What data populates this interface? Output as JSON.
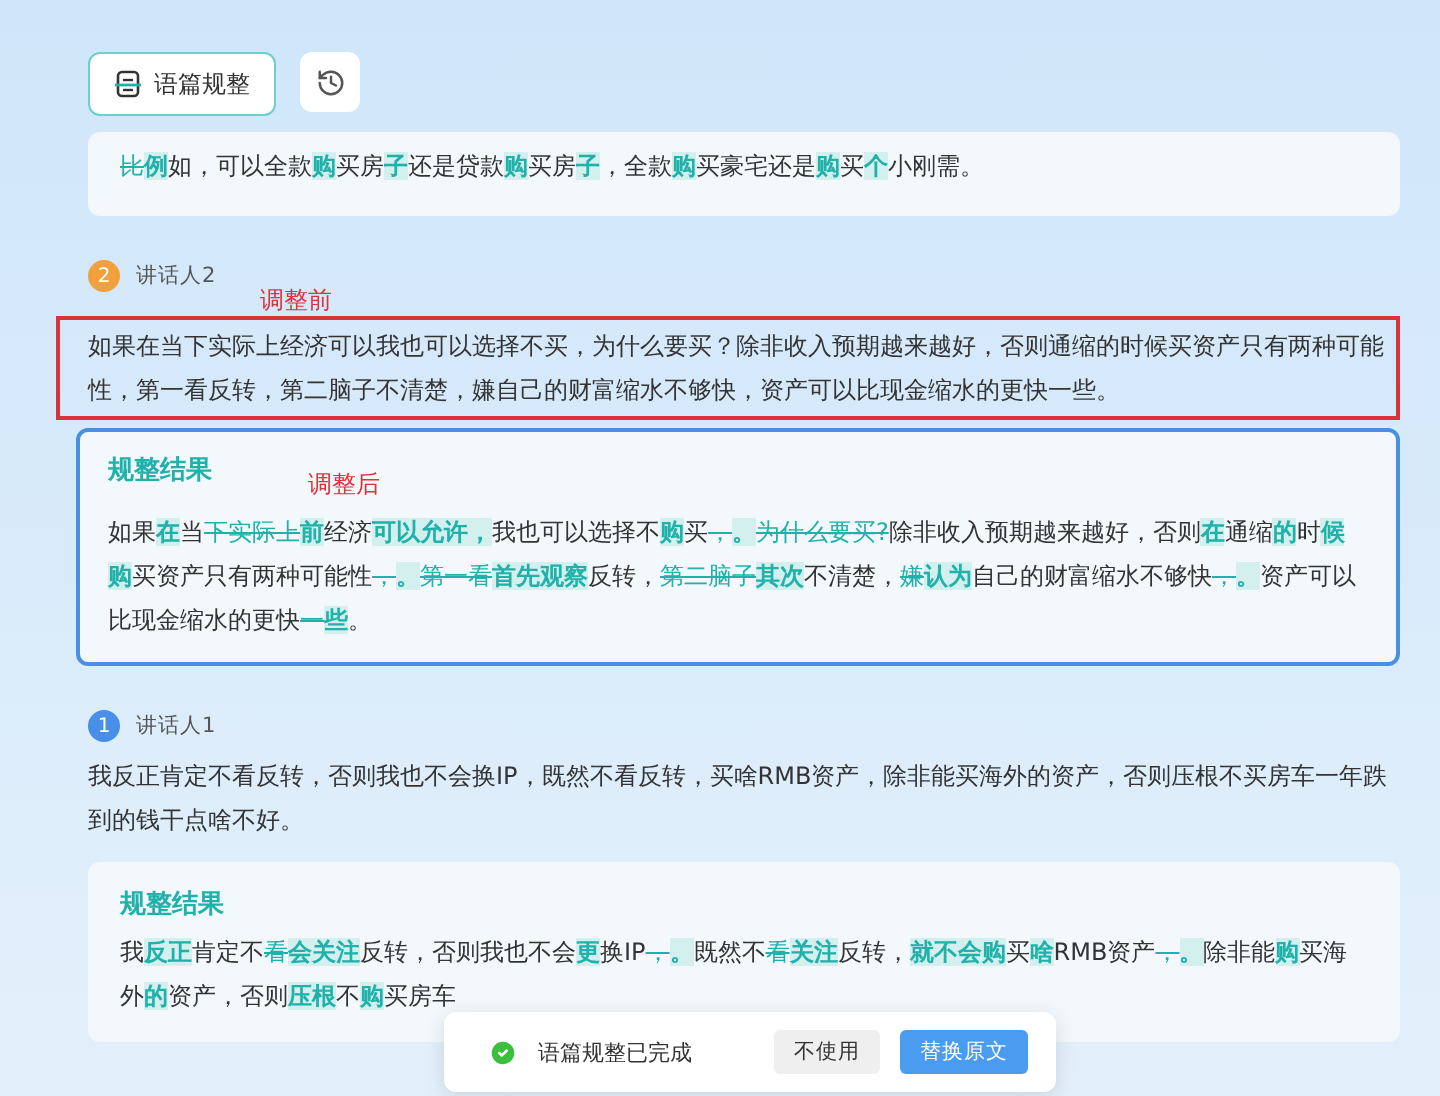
{
  "toolbar": {
    "tidy_button": "语篇规整"
  },
  "blocks": [
    {
      "framed": false,
      "result": [
        {
          "kind": "removed",
          "text": "比"
        },
        {
          "kind": "added",
          "text": "例"
        },
        {
          "kind": "plain",
          "text": "如，可以全款"
        },
        {
          "kind": "added",
          "text": "购"
        },
        {
          "kind": "plain",
          "text": "买房"
        },
        {
          "kind": "added",
          "text": "子"
        },
        {
          "kind": "plain",
          "text": "还是贷款"
        },
        {
          "kind": "added",
          "text": "购"
        },
        {
          "kind": "plain",
          "text": "买房"
        },
        {
          "kind": "added",
          "text": "子"
        },
        {
          "kind": "plain",
          "text": "，全款"
        },
        {
          "kind": "added",
          "text": "购"
        },
        {
          "kind": "plain",
          "text": "买豪宅还是"
        },
        {
          "kind": "added",
          "text": "购"
        },
        {
          "kind": "plain",
          "text": "买"
        },
        {
          "kind": "added",
          "text": "个"
        },
        {
          "kind": "plain",
          "text": "小刚需。"
        }
      ]
    },
    {
      "speaker": {
        "number": "2",
        "name": "讲话人2",
        "color": "#f0a03c"
      },
      "original_note": "调整前",
      "original_framed": true,
      "original": "如果在当下实际上经济可以我也可以选择不买，为什么要买？除非收入预期越来越好，否则通缩的时候买资产只有两种可能性，第一看反转，第二脑子不清楚，嫌自己的财富缩水不够快，资产可以比现金缩水的更快一些。",
      "result_title": "规整结果",
      "result_note": "调整后",
      "framed": true,
      "result": [
        {
          "kind": "plain",
          "text": "如果"
        },
        {
          "kind": "added",
          "text": "在"
        },
        {
          "kind": "plain",
          "text": "当"
        },
        {
          "kind": "removed",
          "text": "下实际上"
        },
        {
          "kind": "added",
          "text": "前"
        },
        {
          "kind": "plain",
          "text": "经济"
        },
        {
          "kind": "added",
          "text": "可以允许，"
        },
        {
          "kind": "plain",
          "text": "我也可以选择不"
        },
        {
          "kind": "added",
          "text": "购"
        },
        {
          "kind": "plain",
          "text": "买"
        },
        {
          "kind": "removed",
          "text": "，"
        },
        {
          "kind": "added",
          "text": "。"
        },
        {
          "kind": "removed",
          "text": "为什么要买?"
        },
        {
          "kind": "plain",
          "text": "除非收入预期越来越好，否则"
        },
        {
          "kind": "added",
          "text": "在"
        },
        {
          "kind": "plain",
          "text": "通缩"
        },
        {
          "kind": "added",
          "text": "的"
        },
        {
          "kind": "plain",
          "text": "时"
        },
        {
          "kind": "added",
          "text": "候购"
        },
        {
          "kind": "plain",
          "text": "买资产只有两种可能性"
        },
        {
          "kind": "removed",
          "text": "，"
        },
        {
          "kind": "added",
          "text": "。"
        },
        {
          "kind": "removed",
          "text": "第一看"
        },
        {
          "kind": "added",
          "text": "首先观察"
        },
        {
          "kind": "plain",
          "text": "反转，"
        },
        {
          "kind": "removed",
          "text": "第二脑子"
        },
        {
          "kind": "added",
          "text": "其次"
        },
        {
          "kind": "plain",
          "text": "不清楚，"
        },
        {
          "kind": "removed",
          "text": "嫌"
        },
        {
          "kind": "added",
          "text": "认为"
        },
        {
          "kind": "plain",
          "text": "自己的财富缩水不够快"
        },
        {
          "kind": "removed",
          "text": "，"
        },
        {
          "kind": "added",
          "text": "。"
        },
        {
          "kind": "plain",
          "text": "资产可以比现金缩水的更快"
        },
        {
          "kind": "removed",
          "text": "一"
        },
        {
          "kind": "added",
          "text": "些"
        },
        {
          "kind": "plain",
          "text": "。"
        }
      ]
    },
    {
      "speaker": {
        "number": "1",
        "name": "讲话人1",
        "color": "#4a8fe7"
      },
      "original_framed": false,
      "original": "我反正肯定不看反转，否则我也不会换IP，既然不看反转，买啥RMB资产，除非能买海外的资产，否则压根不买房车一年跌到的钱干点啥不好。",
      "result_title": "规整结果",
      "framed": false,
      "result": [
        {
          "kind": "plain",
          "text": "我"
        },
        {
          "kind": "added",
          "text": "反正"
        },
        {
          "kind": "plain",
          "text": "肯定不"
        },
        {
          "kind": "removed",
          "text": "看"
        },
        {
          "kind": "added",
          "text": "会关注"
        },
        {
          "kind": "plain",
          "text": "反转，否则我也不会"
        },
        {
          "kind": "added",
          "text": "更"
        },
        {
          "kind": "plain",
          "text": "换IP"
        },
        {
          "kind": "removed",
          "text": "，"
        },
        {
          "kind": "added",
          "text": "。"
        },
        {
          "kind": "plain",
          "text": "既然不"
        },
        {
          "kind": "removed",
          "text": "看"
        },
        {
          "kind": "added",
          "text": "关注"
        },
        {
          "kind": "plain",
          "text": "反转，"
        },
        {
          "kind": "added",
          "text": "就不会购"
        },
        {
          "kind": "plain",
          "text": "买"
        },
        {
          "kind": "added",
          "text": "啥"
        },
        {
          "kind": "plain",
          "text": "RMB资产"
        },
        {
          "kind": "removed",
          "text": "，"
        },
        {
          "kind": "added",
          "text": "。"
        },
        {
          "kind": "plain",
          "text": "除非能"
        },
        {
          "kind": "added",
          "text": "购"
        },
        {
          "kind": "plain",
          "text": "买海外"
        },
        {
          "kind": "added",
          "text": "的"
        },
        {
          "kind": "plain",
          "text": "资产，否则"
        },
        {
          "kind": "added",
          "text": "压根"
        },
        {
          "kind": "plain",
          "text": "不"
        },
        {
          "kind": "added",
          "text": "购"
        },
        {
          "kind": "plain",
          "text": "买房车"
        }
      ]
    }
  ],
  "toast": {
    "message": "语篇规整已完成",
    "decline_button": "不使用",
    "replace_button": "替换原文"
  }
}
